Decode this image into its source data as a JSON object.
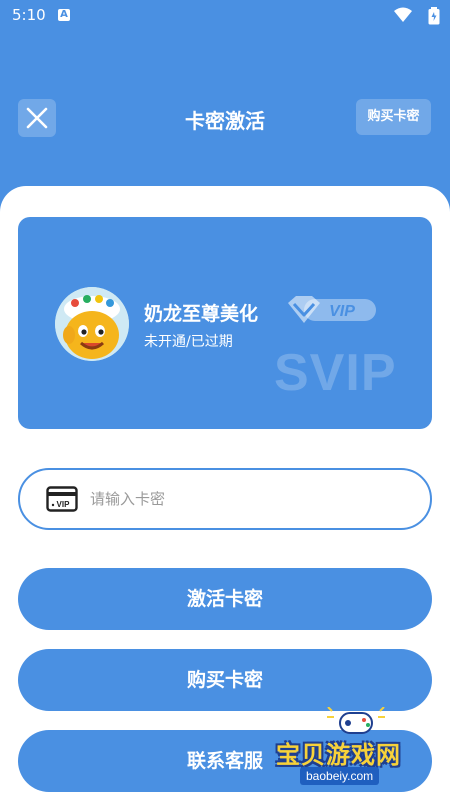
{
  "status_bar": {
    "time": "5:10",
    "notification_letter": "A"
  },
  "header": {
    "title": "卡密激活",
    "buy_label": "购买卡密"
  },
  "vip_card": {
    "product_name": "奶龙至尊美化",
    "status": "未开通/已过期",
    "badge_text": "VIP",
    "watermark": "SVIP"
  },
  "card_input": {
    "value": "",
    "placeholder": "请输入卡密"
  },
  "buttons": {
    "activate": "激活卡密",
    "buy": "购买卡密",
    "contact": "联系客服"
  },
  "site_logo": {
    "title": "宝贝游戏网",
    "url": "baobeiy.com"
  },
  "colors": {
    "primary": "#4a90e2",
    "background": "#ffffff",
    "placeholder": "#9a9a9a"
  }
}
